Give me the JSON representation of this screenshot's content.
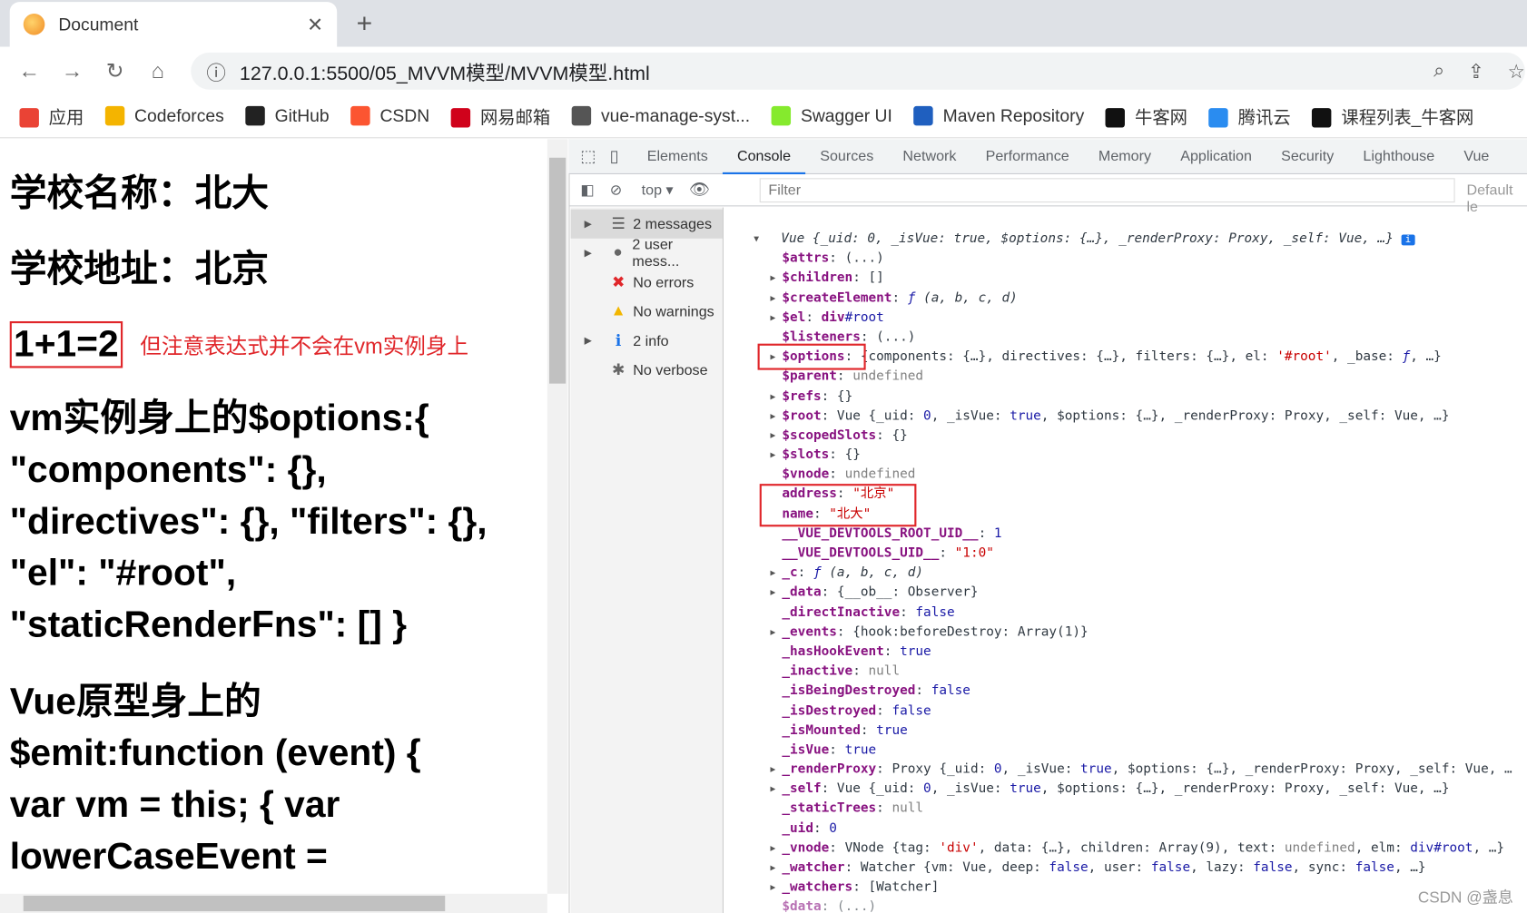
{
  "browser": {
    "tab_title": "Document",
    "url": "127.0.0.1:5500/05_MVVM模型/MVVM模型.html",
    "bookmarks": [
      {
        "label": "应用",
        "color": "#ea4335"
      },
      {
        "label": "Codeforces",
        "color": "#f4b400"
      },
      {
        "label": "GitHub",
        "color": "#222222"
      },
      {
        "label": "CSDN",
        "color": "#fc5531"
      },
      {
        "label": "网易邮箱",
        "color": "#d0021b"
      },
      {
        "label": "vue-manage-syst...",
        "color": "#555555"
      },
      {
        "label": "Swagger UI",
        "color": "#85ea2d"
      },
      {
        "label": "Maven Repository",
        "color": "#1f5fbf"
      },
      {
        "label": "牛客网",
        "color": "#111111"
      },
      {
        "label": "腾讯云",
        "color": "#2a8cf0"
      },
      {
        "label": "课程列表_牛客网",
        "color": "#111111"
      }
    ]
  },
  "page": {
    "school_name": "学校名称：北大",
    "school_address": "学校地址：北京",
    "expression": "1+1=2",
    "note": "但注意表达式并不会在vm实例身上",
    "options_lines": [
      "vm实例身上的$options:{",
      "\"components\": {},",
      "\"directives\": {}, \"filters\": {},",
      "\"el\": \"#root\",",
      "\"staticRenderFns\": [] }"
    ],
    "proto_lines": [
      "Vue原型身上的",
      "$emit:function (event) {",
      "var vm = this; { var",
      "lowerCaseEvent ="
    ]
  },
  "devtools": {
    "tabs": [
      "Elements",
      "Console",
      "Sources",
      "Network",
      "Performance",
      "Memory",
      "Application",
      "Security",
      "Lighthouse",
      "Vue"
    ],
    "active_tab": "Console",
    "context": "top",
    "filter_placeholder": "Filter",
    "levels": "Default le",
    "sidebar": [
      {
        "label": "2 messages",
        "icon": "list-icon",
        "arrow": true
      },
      {
        "label": "2 user mess...",
        "icon": "user-icon",
        "arrow": true
      },
      {
        "label": "No errors",
        "icon": "error-icon",
        "arrow": false
      },
      {
        "label": "No warnings",
        "icon": "warning-icon",
        "arrow": false
      },
      {
        "label": "2 info",
        "icon": "info-icon",
        "arrow": true
      },
      {
        "label": "No verbose",
        "icon": "bug-icon",
        "arrow": false
      }
    ],
    "console_header": "Vue {_uid: 0, _isVue: true, $options: {…}, _renderProxy: Proxy, _self: Vue, …}",
    "rows": [
      {
        "e": 0,
        "k": "$attrs",
        "v": [
          [
            "(...)",
            ""
          ]
        ]
      },
      {
        "e": 1,
        "k": "$children",
        "v": [
          [
            "[]",
            ""
          ]
        ]
      },
      {
        "e": 1,
        "k": "$createElement",
        "v": [
          [
            "ƒ",
            "n it2"
          ],
          [
            " (a, b, c, d)",
            "it2"
          ]
        ]
      },
      {
        "e": 1,
        "k": "$el",
        "v": [
          [
            "div",
            "k"
          ],
          [
            "#root",
            "n"
          ]
        ]
      },
      {
        "e": 0,
        "k": "$listeners",
        "v": [
          [
            "(...)",
            ""
          ]
        ]
      },
      {
        "e": 1,
        "k": "$options",
        "v": [
          [
            "{components: {…}, directives: {…}, filters: {…}, el: ",
            ""
          ],
          [
            "'#root'",
            "s"
          ],
          [
            ", _base: ",
            ""
          ],
          [
            "ƒ",
            "n it2"
          ],
          [
            ", …}",
            ""
          ]
        ]
      },
      {
        "e": 0,
        "k": "$parent",
        "v": [
          [
            "undefined",
            "g"
          ]
        ]
      },
      {
        "e": 1,
        "k": "$refs",
        "v": [
          [
            "{}",
            ""
          ]
        ]
      },
      {
        "e": 1,
        "k": "$root",
        "v": [
          [
            "Vue {_uid: ",
            ""
          ],
          [
            "0",
            "n"
          ],
          [
            ", _isVue: ",
            ""
          ],
          [
            "true",
            "n"
          ],
          [
            ", $options: {…}, _renderProxy: Proxy, _self: Vue, …}",
            ""
          ]
        ]
      },
      {
        "e": 1,
        "k": "$scopedSlots",
        "v": [
          [
            "{}",
            ""
          ]
        ]
      },
      {
        "e": 1,
        "k": "$slots",
        "v": [
          [
            "{}",
            ""
          ]
        ]
      },
      {
        "e": 0,
        "k": "$vnode",
        "v": [
          [
            "undefined",
            "g"
          ]
        ]
      },
      {
        "e": 0,
        "k": "address",
        "v": [
          [
            "\"北京\"",
            "s"
          ]
        ]
      },
      {
        "e": 0,
        "k": "name",
        "v": [
          [
            "\"北大\"",
            "s"
          ]
        ]
      },
      {
        "e": 0,
        "k": "__VUE_DEVTOOLS_ROOT_UID__",
        "v": [
          [
            "1",
            "n"
          ]
        ]
      },
      {
        "e": 0,
        "k": "__VUE_DEVTOOLS_UID__",
        "v": [
          [
            "\"1:0\"",
            "s"
          ]
        ]
      },
      {
        "e": 1,
        "k": "_c",
        "v": [
          [
            "ƒ",
            "n it2"
          ],
          [
            " (a, b, c, d)",
            "it2"
          ]
        ]
      },
      {
        "e": 1,
        "k": "_data",
        "v": [
          [
            "{__ob__: Observer}",
            ""
          ]
        ]
      },
      {
        "e": 0,
        "k": "_directInactive",
        "v": [
          [
            "false",
            "n"
          ]
        ]
      },
      {
        "e": 1,
        "k": "_events",
        "v": [
          [
            "{hook:beforeDestroy: Array(1)}",
            ""
          ]
        ]
      },
      {
        "e": 0,
        "k": "_hasHookEvent",
        "v": [
          [
            "true",
            "n"
          ]
        ]
      },
      {
        "e": 0,
        "k": "_inactive",
        "v": [
          [
            "null",
            "g"
          ]
        ]
      },
      {
        "e": 0,
        "k": "_isBeingDestroyed",
        "v": [
          [
            "false",
            "n"
          ]
        ]
      },
      {
        "e": 0,
        "k": "_isDestroyed",
        "v": [
          [
            "false",
            "n"
          ]
        ]
      },
      {
        "e": 0,
        "k": "_isMounted",
        "v": [
          [
            "true",
            "n"
          ]
        ]
      },
      {
        "e": 0,
        "k": "_isVue",
        "v": [
          [
            "true",
            "n"
          ]
        ]
      },
      {
        "e": 1,
        "k": "_renderProxy",
        "v": [
          [
            "Proxy {_uid: ",
            ""
          ],
          [
            "0",
            "n"
          ],
          [
            ", _isVue: ",
            ""
          ],
          [
            "true",
            "n"
          ],
          [
            ", $options: {…}, _renderProxy: Proxy, _self: Vue, …",
            ""
          ]
        ]
      },
      {
        "e": 1,
        "k": "_self",
        "v": [
          [
            "Vue {_uid: ",
            ""
          ],
          [
            "0",
            "n"
          ],
          [
            ", _isVue: ",
            ""
          ],
          [
            "true",
            "n"
          ],
          [
            ", $options: {…}, _renderProxy: Proxy, _self: Vue, …}",
            ""
          ]
        ]
      },
      {
        "e": 0,
        "k": "_staticTrees",
        "v": [
          [
            "null",
            "g"
          ]
        ]
      },
      {
        "e": 0,
        "k": "_uid",
        "v": [
          [
            "0",
            "n"
          ]
        ]
      },
      {
        "e": 1,
        "k": "_vnode",
        "v": [
          [
            "VNode {tag: ",
            ""
          ],
          [
            "'div'",
            "s"
          ],
          [
            ", data: {…}, children: Array(9), text: ",
            ""
          ],
          [
            "undefined",
            "g"
          ],
          [
            ", elm: ",
            ""
          ],
          [
            "div#root",
            "n"
          ],
          [
            ", …}",
            ""
          ]
        ]
      },
      {
        "e": 1,
        "k": "_watcher",
        "v": [
          [
            "Watcher {vm: Vue, deep: ",
            ""
          ],
          [
            "false",
            "n"
          ],
          [
            ", user: ",
            ""
          ],
          [
            "false",
            "n"
          ],
          [
            ", lazy: ",
            ""
          ],
          [
            "false",
            "n"
          ],
          [
            ", sync: ",
            ""
          ],
          [
            "false",
            "n"
          ],
          [
            ", …}",
            ""
          ]
        ]
      },
      {
        "e": 1,
        "k": "_watchers",
        "v": [
          [
            "[Watcher]",
            ""
          ]
        ]
      },
      {
        "e": 0,
        "k": "$data",
        "v": [
          [
            "(...)",
            ""
          ]
        ]
      }
    ]
  },
  "watermark": "CSDN @盏息"
}
